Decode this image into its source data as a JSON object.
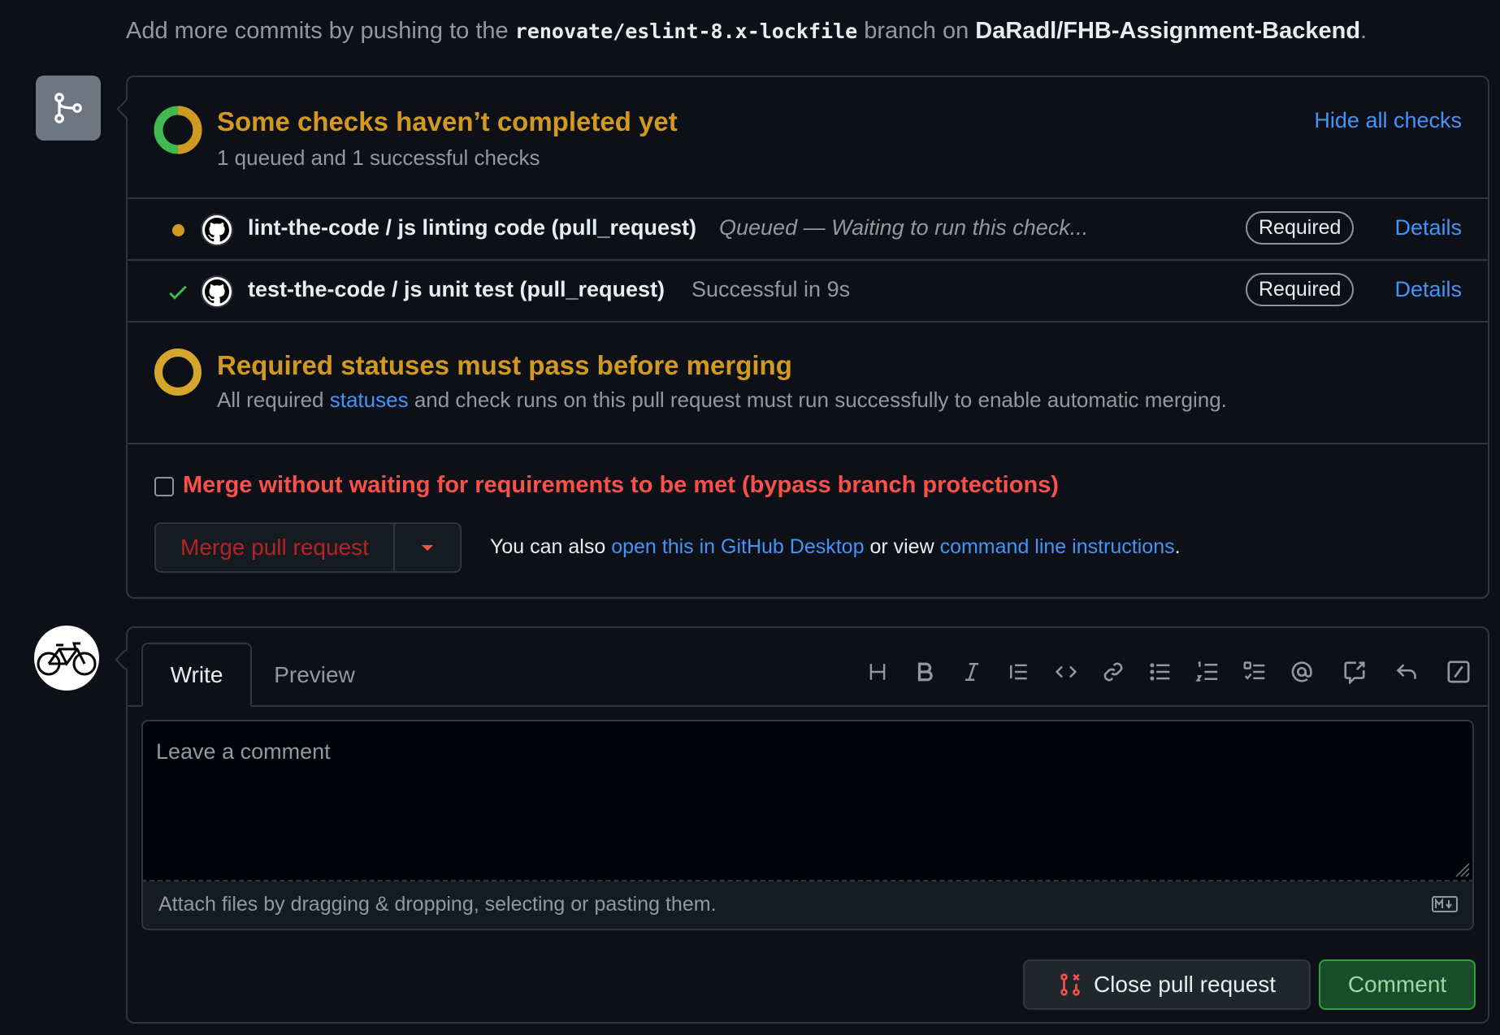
{
  "hint": {
    "prefix": "Add more commits by pushing to the",
    "branch": "renovate/eslint-8.x-lockfile",
    "middle": "branch on",
    "repo": "DaRadl/FHB-Assignment-Backend",
    "suffix": "."
  },
  "checks": {
    "title": "Some checks haven’t completed yet",
    "subtitle": "1 queued and 1 successful checks",
    "toggle_label": "Hide all checks",
    "items": [
      {
        "name": "lint-the-code / js linting code (pull_request)",
        "status": "Queued — Waiting to run this check...",
        "badge": "Required",
        "details_label": "Details",
        "state": "queued"
      },
      {
        "name": "test-the-code / js unit test (pull_request)",
        "status": "Successful in 9s",
        "badge": "Required",
        "details_label": "Details",
        "state": "success"
      }
    ]
  },
  "required": {
    "title": "Required statuses must pass before merging",
    "desc_prefix": "All required",
    "desc_link": "statuses",
    "desc_suffix": "and check runs on this pull request must run successfully to enable automatic merging."
  },
  "merge": {
    "bypass_label": "Merge without waiting for requirements to be met (bypass branch protections)",
    "button_label": "Merge pull request",
    "also_prefix": "You can also",
    "desktop_link": "open this in GitHub Desktop",
    "also_middle": "or view",
    "cli_link": "command line instructions",
    "also_suffix": "."
  },
  "comment": {
    "tabs": [
      "Write",
      "Preview"
    ],
    "placeholder": "Leave a comment",
    "attach_text": "Attach files by dragging & dropping, selecting or pasting them.",
    "close_label": "Close pull request",
    "comment_label": "Comment"
  },
  "toolbar_icons": [
    "heading-icon",
    "bold-icon",
    "italic-icon",
    "quote-icon",
    "code-icon",
    "link-icon",
    "unordered-list-icon",
    "ordered-list-icon",
    "task-list-icon",
    "mention-icon",
    "cross-reference-icon",
    "reply-icon",
    "slash-commands-icon"
  ],
  "colors": {
    "background": "#0d1117",
    "pending": "#d29922",
    "success": "#3fb950",
    "danger": "#f85149",
    "link": "#4493f8"
  }
}
